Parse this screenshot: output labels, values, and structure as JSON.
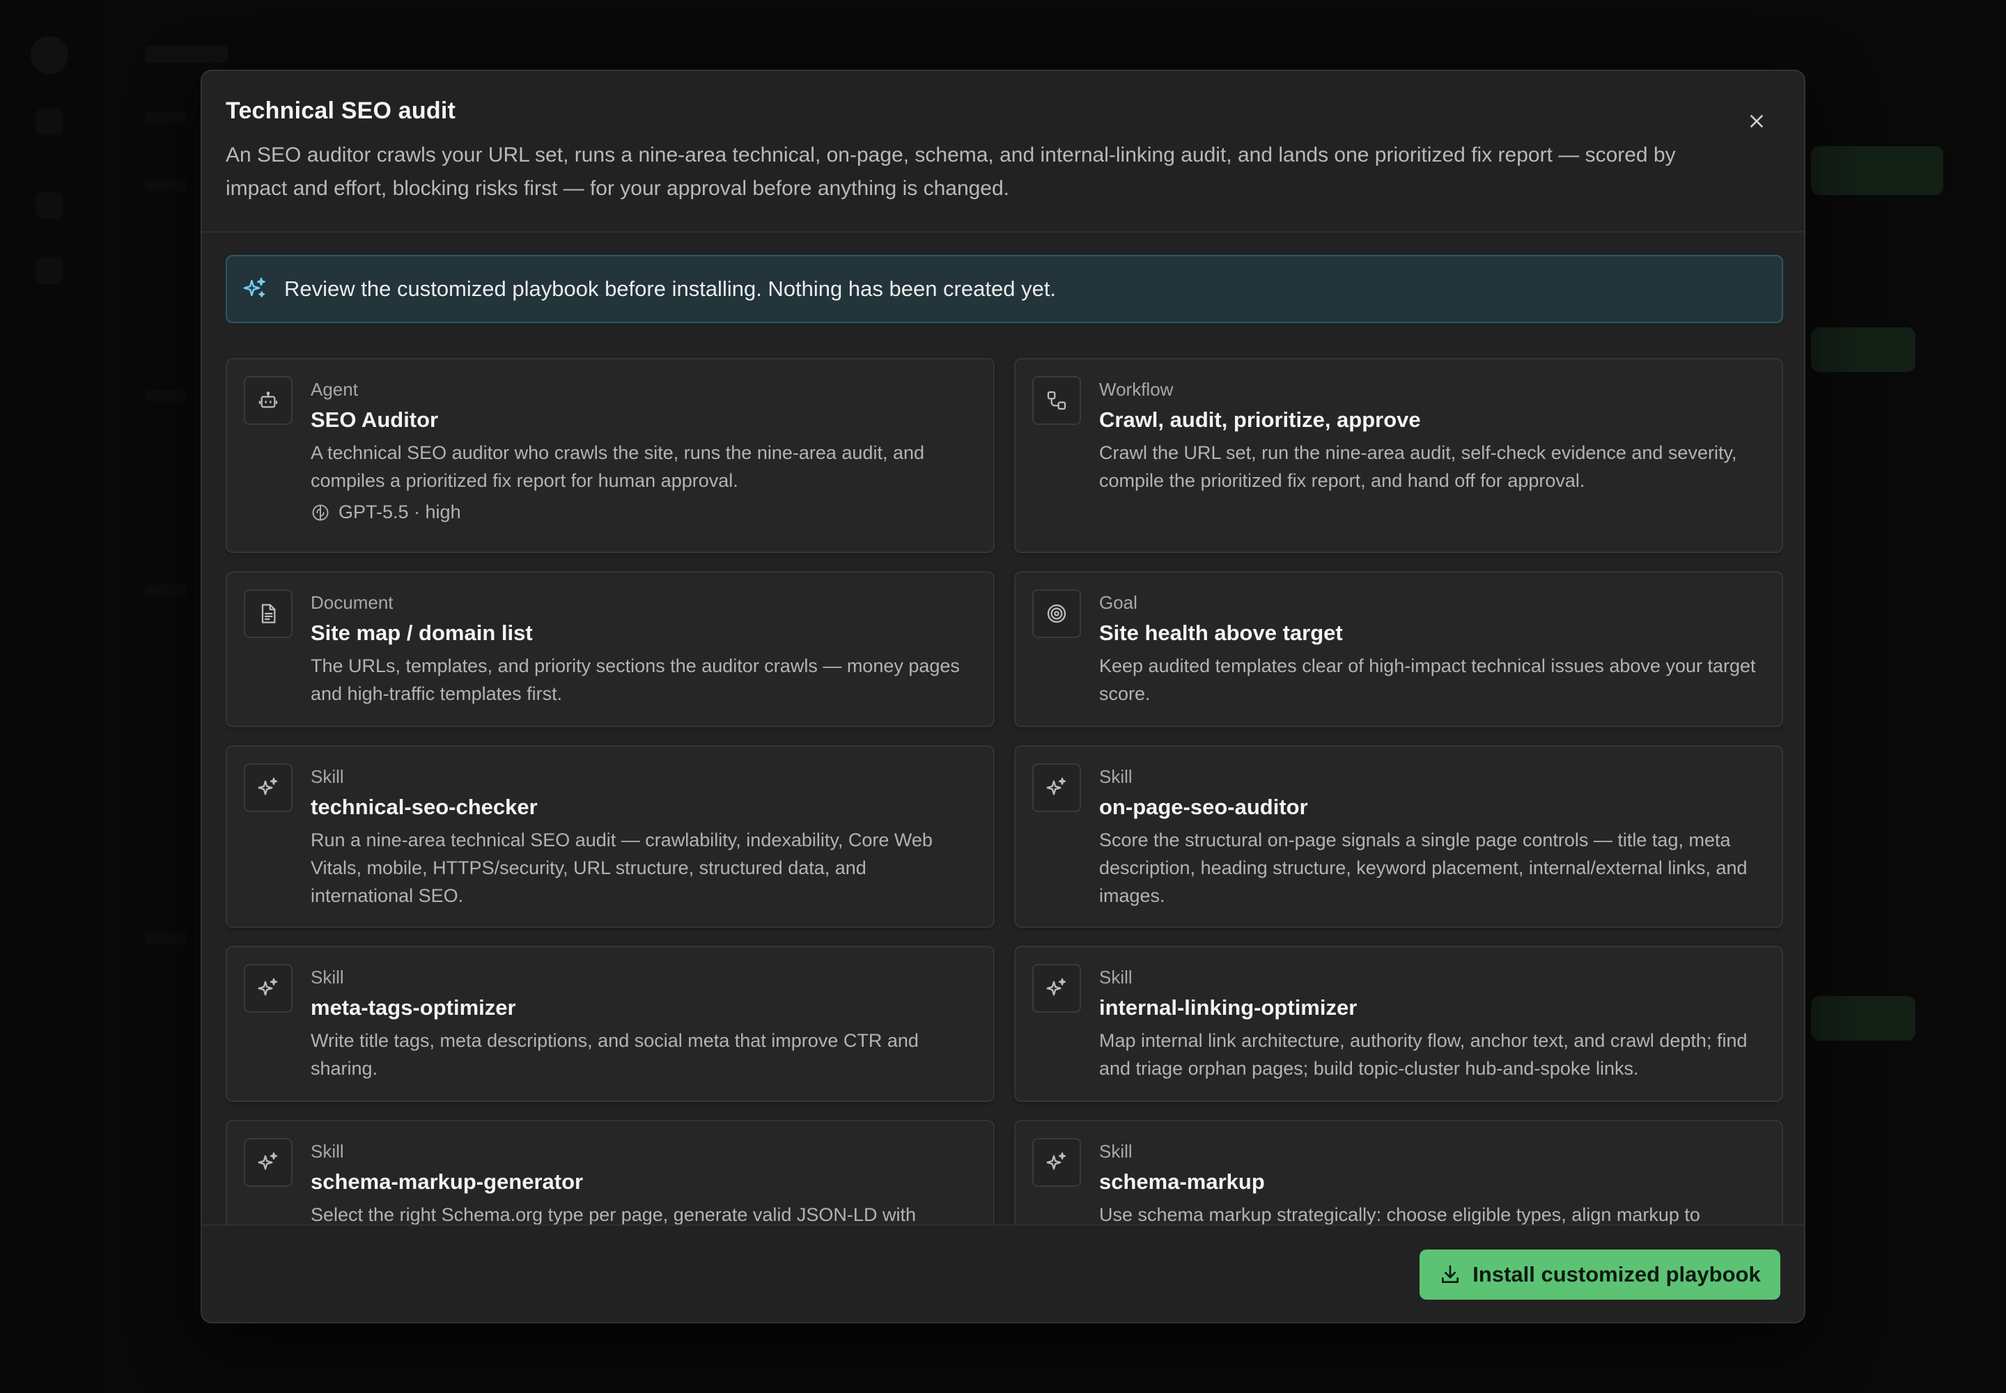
{
  "colors": {
    "accent_green": "#5cc374",
    "notice_bg": "#23343b",
    "notice_border": "#2f5866",
    "notice_icon": "#6fd0f0",
    "modal_bg": "#222222"
  },
  "modal": {
    "title": "Technical SEO audit",
    "description": "An SEO auditor crawls your URL set, runs a nine-area technical, on-page, schema, and internal-linking audit, and lands one prioritized fix report — scored by impact and effort, blocking risks first — for your approval before anything is changed.",
    "close_icon": "close-icon"
  },
  "notice": {
    "icon": "sparkle-icon",
    "text": "Review the customized playbook before installing. Nothing has been created yet."
  },
  "cards": [
    {
      "kind": "Agent",
      "icon": "robot-icon",
      "title": "SEO Auditor",
      "description": "A technical SEO auditor who crawls the site, runs the nine-area audit, and compiles a prioritized fix report for human approval.",
      "meta_icon": "brain-icon",
      "meta": "GPT-5.5 · high"
    },
    {
      "kind": "Workflow",
      "icon": "workflow-icon",
      "title": "Crawl, audit, prioritize, approve",
      "description": "Crawl the URL set, run the nine-area audit, self-check evidence and severity, compile the prioritized fix report, and hand off for approval."
    },
    {
      "kind": "Document",
      "icon": "document-icon",
      "title": "Site map / domain list",
      "description": "The URLs, templates, and priority sections the auditor crawls — money pages and high-traffic templates first."
    },
    {
      "kind": "Goal",
      "icon": "target-icon",
      "title": "Site health above target",
      "description": "Keep audited templates clear of high-impact technical issues above your target score."
    },
    {
      "kind": "Skill",
      "icon": "sparkle-icon",
      "title": "technical-seo-checker",
      "description": "Run a nine-area technical SEO audit — crawlability, indexability, Core Web Vitals, mobile, HTTPS/security, URL structure, structured data, and international SEO."
    },
    {
      "kind": "Skill",
      "icon": "sparkle-icon",
      "title": "on-page-seo-auditor",
      "description": "Score the structural on-page signals a single page controls — title tag, meta description, heading structure, keyword placement, internal/external links, and images."
    },
    {
      "kind": "Skill",
      "icon": "sparkle-icon",
      "title": "meta-tags-optimizer",
      "description": "Write title tags, meta descriptions, and social meta that improve CTR and sharing."
    },
    {
      "kind": "Skill",
      "icon": "sparkle-icon",
      "title": "internal-linking-optimizer",
      "description": "Map internal link architecture, authority flow, anchor text, and crawl depth; find and triage orphan pages; build topic-cluster hub-and-spoke links."
    },
    {
      "kind": "Skill",
      "icon": "sparkle-icon",
      "title": "schema-markup-generator",
      "description": "Select the right Schema.org type per page, generate valid JSON-LD with"
    },
    {
      "kind": "Skill",
      "icon": "sparkle-icon",
      "title": "schema-markup",
      "description": "Use schema markup strategically: choose eligible types, align markup to"
    }
  ],
  "footer": {
    "install_icon": "download-icon",
    "install_label": "Install customized playbook"
  }
}
